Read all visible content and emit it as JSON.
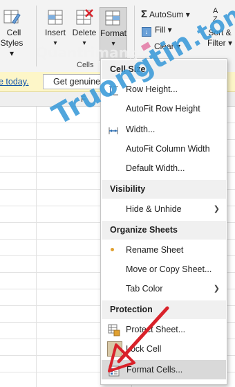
{
  "ribbon": {
    "cell_styles": {
      "line1": "Cell",
      "line2": "Styles ▾"
    },
    "insert": {
      "label": "Insert",
      "arrow": "▾"
    },
    "delete": {
      "label": "Delete",
      "arrow": "▾"
    },
    "format": {
      "label": "Format",
      "arrow": "▾"
    },
    "cells_group": "Cells",
    "autosum": "AutoSum ▾",
    "fill": "Fill ▾",
    "clear": "Clear ▾",
    "sort_filter": {
      "line1": "Sort &",
      "line2": "Filter ▾"
    }
  },
  "message_bar": {
    "link": "e today.",
    "button": "Get genuine"
  },
  "sheet": {
    "column_f": "F"
  },
  "menu": {
    "sections": {
      "cell_size": "Cell Size",
      "visibility": "Visibility",
      "organize": "Organize Sheets",
      "protection": "Protection"
    },
    "items": {
      "row_height": "Row Height...",
      "autofit_row": "AutoFit Row Height",
      "width": "Width...",
      "autofit_col": "AutoFit Column Width",
      "default_width": "Default Width...",
      "hide_unhide": "Hide & Unhide",
      "rename": "Rename Sheet",
      "move_copy": "Move or Copy Sheet...",
      "tab_color": "Tab Color",
      "protect": "Protect Sheet...",
      "lock": "Lock Cell",
      "format_cells": "Format Cells..."
    }
  },
  "watermark": {
    "main": "Truongtin",
    "tld": ".ton",
    "logo": "Quantrimang"
  },
  "colors": {
    "menu_bg": "#ffffff",
    "header_bg": "#f0f0f0",
    "selected_bg": "#d9d9d9",
    "accent_red": "#d9222a",
    "watermark_blue": "#3a9ad9"
  }
}
